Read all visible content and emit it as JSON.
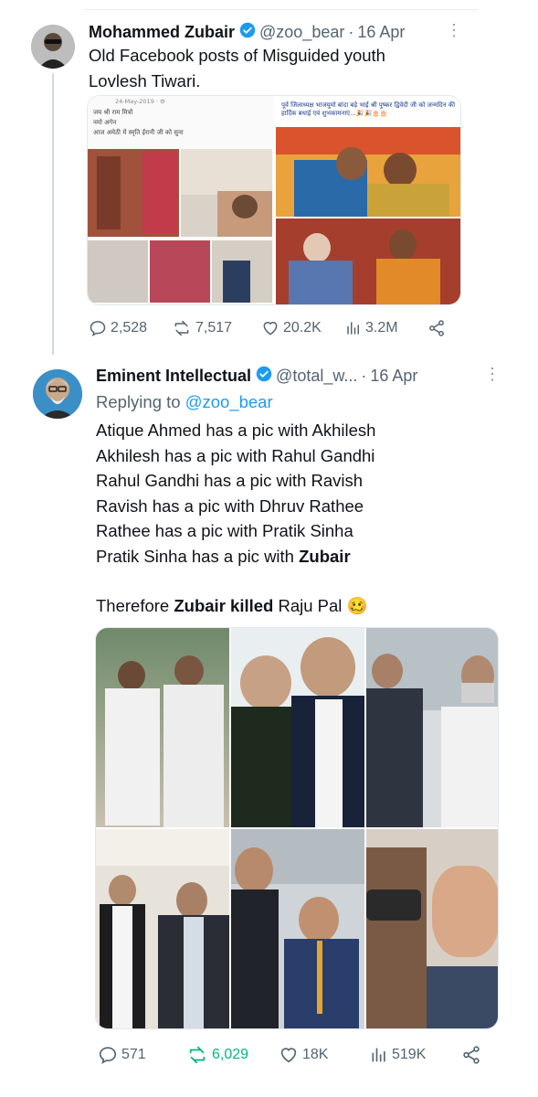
{
  "tweet1": {
    "name": "Mohammed Zubair",
    "handle": "@zoo_bear",
    "dot": "·",
    "date": "16 Apr",
    "text_line1": "Old Facebook posts of Misguided youth",
    "text_line2": "Lovlesh Tiwari.",
    "media_left": {
      "date_stamp": "24-May-2019 · ⚙",
      "line1": "जय श्री राम मित्रों",
      "line2": "नमो अगेन",
      "line3": "आज अमेठी में स्मृति ईरानी जी को सुना"
    },
    "media_right": {
      "caption": "पूर्व जिलाध्यक्ष भाजयुमो बांदा बड़े भाई श्री पुष्कर द्विवेदी जी को जन्मदिन की हार्दिक बधाई एवं शुभकामनाएं...🎉🎉🎂🎂"
    },
    "replies": "2,528",
    "reposts": "7,517",
    "likes": "20.2K",
    "views": "3.2M"
  },
  "tweet2": {
    "name": "Eminent Intellectual",
    "handle": "@total_w...",
    "dot": "·",
    "date": "16 Apr",
    "replying_prefix": "Replying to ",
    "replying_handle": "@zoo_bear",
    "lines": [
      "Atique Ahmed has a pic with Akhilesh",
      "Akhilesh has a pic with Rahul Gandhi",
      "Rahul Gandhi has a pic with Ravish",
      "Ravish has a pic with Dhruv Rathee",
      "Rathee has a pic with Pratik Sinha"
    ],
    "line6_prefix": "Pratik Sinha has a pic with ",
    "line6_bold": "Zubair",
    "therefore_prefix": "Therefore ",
    "therefore_bold": "Zubair killed",
    "therefore_suffix": " Raju Pal ",
    "emoji": "🥴",
    "replies": "571",
    "reposts": "6,029",
    "likes": "18K",
    "views": "519K"
  },
  "icons": {
    "verified": "verified-badge-icon",
    "more": "more-icon",
    "reply": "reply-icon",
    "repost": "repost-icon",
    "like": "like-icon",
    "views": "views-icon",
    "share": "share-icon"
  },
  "colors": {
    "text": "#0f1419",
    "secondary": "#536471",
    "accent": "#1d9bf0",
    "repost_active": "#00ba7c",
    "thread_line": "#cfd9de"
  },
  "more_glyph": "⋮"
}
